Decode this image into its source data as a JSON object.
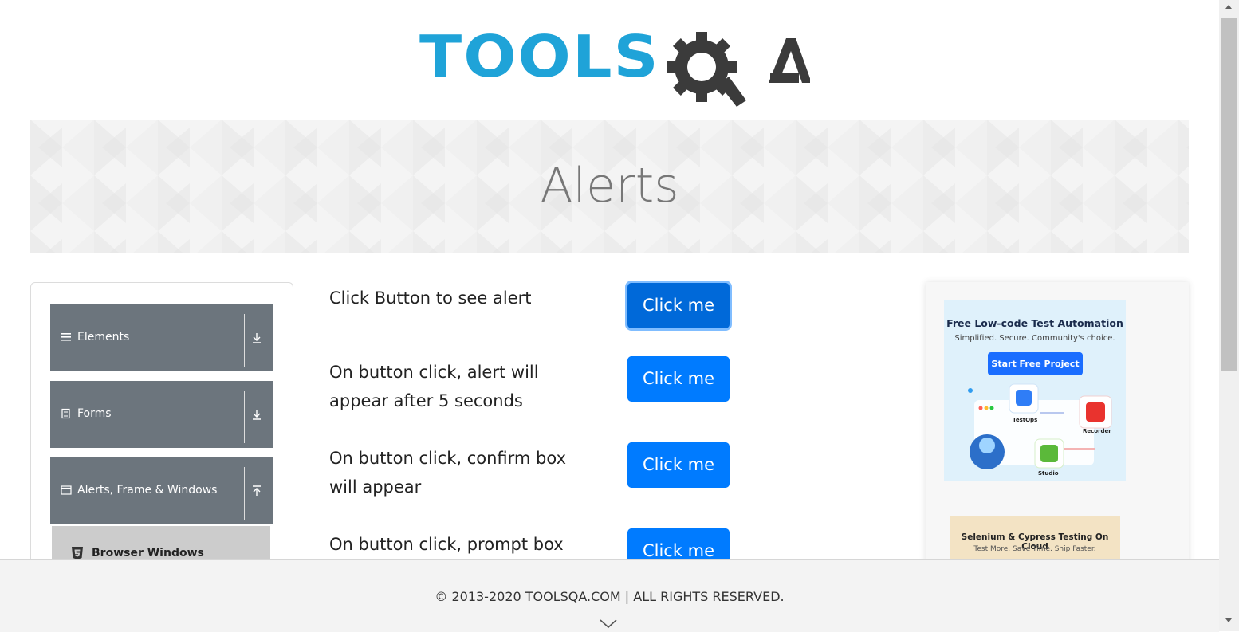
{
  "brand": {
    "logo_tools": "TOOLS",
    "logo_qa": "QA",
    "color_tools": "#1fa3d8",
    "color_qa": "#3b3b3b"
  },
  "banner": {
    "title": "Alerts"
  },
  "sidebar": {
    "groups": [
      {
        "label": "Elements",
        "icon": "hamburger-icon",
        "arrow": "download-arrow-icon"
      },
      {
        "label": "Forms",
        "icon": "document-icon",
        "arrow": "download-arrow-icon"
      },
      {
        "label": "Alerts, Frame & Windows",
        "icon": "window-icon",
        "arrow": "upload-arrow-icon"
      }
    ],
    "active_subitem": {
      "label": "Browser Windows",
      "icon": "html5-icon"
    }
  },
  "alerts": [
    {
      "text": "Click Button to see alert",
      "button": "Click me"
    },
    {
      "text": "On button click, alert will appear after 5 seconds",
      "button": "Click me"
    },
    {
      "text": "On button click, confirm box will appear",
      "button": "Click me"
    },
    {
      "text": "On button click, prompt box",
      "button": "Click me"
    }
  ],
  "ads": {
    "ad1": {
      "title": "Free Low-code Test Automation",
      "subtitle": "Simplified. Secure. Community's choice.",
      "cta": "Start Free Project",
      "tags": [
        "TestOps",
        "Recorder",
        "Studio"
      ]
    },
    "ad2": {
      "title": "Selenium & Cypress Testing On Cloud",
      "subtitle": "Test More. Save Time. Ship Faster."
    }
  },
  "footer": {
    "text": "© 2013-2020 TOOLSQA.COM | ALL RIGHTS RESERVED."
  },
  "colors": {
    "primary": "#007bff",
    "nav_group": "#6c757d",
    "nav_active": "#cccccc"
  }
}
